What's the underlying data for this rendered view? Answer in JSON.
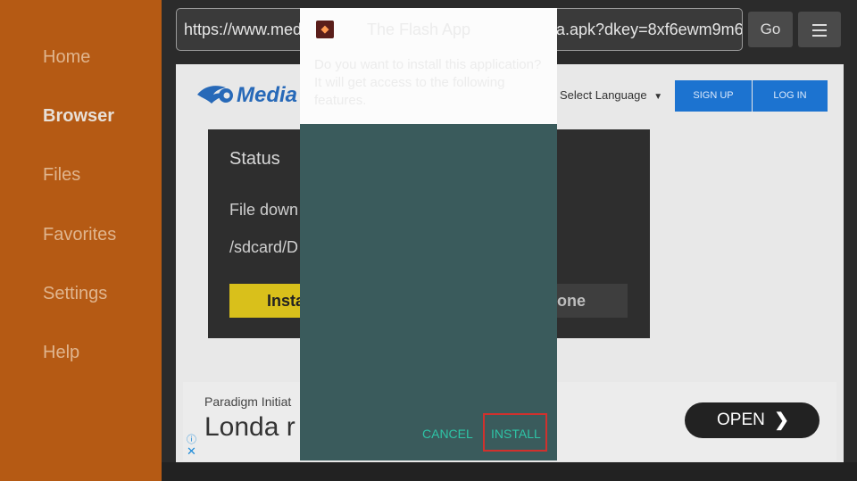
{
  "sidebar": {
    "items": [
      {
        "label": "Home"
      },
      {
        "label": "Browser"
      },
      {
        "label": "Files"
      },
      {
        "label": "Favorites"
      },
      {
        "label": "Settings"
      },
      {
        "label": "Help"
      }
    ],
    "active": "Browser"
  },
  "toolbar": {
    "url": "https://www.mediafire.com/file/dkey/the-app.apk?dkey=8xf6ewm9m6",
    "url_visible_prefix": "https://www.med",
    "url_visible_suffix": "a.apk?dkey=8xf6ewm9m6",
    "go_label": "Go",
    "menu_icon": "hamburger-icon"
  },
  "webpage": {
    "logo_text": "Media",
    "language_label": "Select Language",
    "signup_label": "SIGN UP",
    "login_label": "LOG IN"
  },
  "status_dialog": {
    "title": "Status",
    "message": "File down",
    "path": "/sdcard/D",
    "install_label": "Insta",
    "done_label": "Done"
  },
  "ad": {
    "sponsor": "Paradigm Initiat",
    "headline": "Londa r",
    "open_label": "OPEN",
    "arrow": "❯",
    "info_icon": "ⓘ",
    "close_icon": "✕"
  },
  "install_modal": {
    "app_title": "The Flash App",
    "description": "Do you want to install this application? It will get access to the following features.",
    "cancel_label": "CANCEL",
    "install_label": "INSTALL"
  },
  "colors": {
    "sidebar": "#b55a14",
    "modal_body": "#3a5b5c",
    "accent_button_text": "#2ec4a6",
    "highlight": "#d0312d",
    "status_install": "#d9c01b",
    "signup_blue": "#1c73d0"
  }
}
